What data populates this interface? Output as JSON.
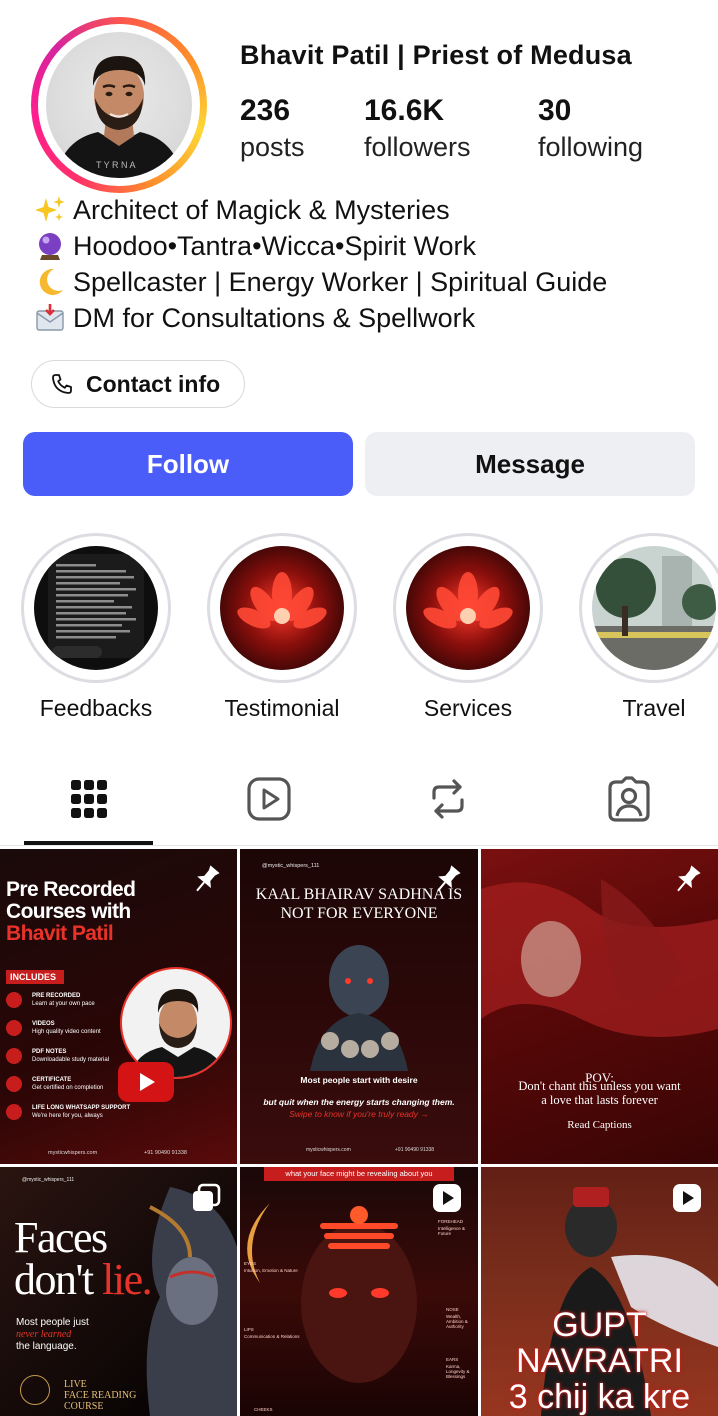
{
  "profile": {
    "name": "Bhavit Patil | Priest of Medusa",
    "stats": [
      {
        "value": "236",
        "label": "posts"
      },
      {
        "value": "16.6K",
        "label": "followers"
      },
      {
        "value": "30",
        "label": "following"
      }
    ],
    "bio": [
      {
        "emoji": "sparkles-icon",
        "text": "Architect of Magick & Mysteries"
      },
      {
        "emoji": "crystal-ball-icon",
        "text": "Hoodoo•Tantra•Wicca•Spirit Work"
      },
      {
        "emoji": "crescent-moon-icon",
        "text": "Spellcaster | Energy Worker | Spiritual Guide"
      },
      {
        "emoji": "inbox-envelope-icon",
        "text": "DM for Consultations & Spellwork"
      }
    ],
    "contact_label": "Contact info"
  },
  "actions": {
    "follow": "Follow",
    "message": "Message",
    "follow_color": "#4a5df9"
  },
  "highlights": [
    {
      "label": "Feedbacks"
    },
    {
      "label": "Testimonial"
    },
    {
      "label": "Services"
    },
    {
      "label": "Travel"
    }
  ],
  "tabs": [
    "grid-icon",
    "reels-icon",
    "reposts-icon",
    "tagged-icon"
  ],
  "posts": [
    {
      "kind": "pinned",
      "title_lines": [
        "Pre Recorded",
        "Courses with"
      ],
      "title_accent": "Bhavit Patil",
      "includes_label": "INCLUDES",
      "features": [
        {
          "title": "PRE RECORDED",
          "sub": "Learn at your own pace"
        },
        {
          "title": "VIDEOS",
          "sub": "High quality video content"
        },
        {
          "title": "PDF NOTES",
          "sub": "Downloadable study material"
        },
        {
          "title": "CERTIFICATE",
          "sub": "Get certified on completion"
        },
        {
          "title": "LIFE LONG WHATSAPP SUPPORT",
          "sub": "We're here for you, always"
        }
      ],
      "footer_left": "mysticwhispers.com",
      "footer_right": "+91 90490 91338"
    },
    {
      "kind": "pinned",
      "handle": "@mystic_whispers_111",
      "headline": "KAAL BHAIRAV SADHNA IS NOT FOR EVERYONE",
      "line1": "Most people start with desire",
      "line2": "but quit when the energy starts changing them.",
      "cta": "Swipe to know if you're truly ready →",
      "footer_left": "mysticwhispers.com",
      "footer_right": "+91 90490 91338"
    },
    {
      "kind": "pinned",
      "pov": "POV:",
      "line1": "Don't chant this unless you want",
      "line2": "a love that lasts forever",
      "caption": "Read Captions"
    },
    {
      "kind": "carousel",
      "handle": "@mystic_whispers_111",
      "title1": "Faces",
      "title2": "don't",
      "title3": "lie.",
      "sub1": "Most people just",
      "sub2": "never learned",
      "sub3": "the language.",
      "badge1": "LIVE",
      "badge2": "FACE READING",
      "badge3": "COURSE"
    },
    {
      "kind": "reel",
      "banner": "what your face might be revealing about you",
      "tags": [
        "FOREHEAD",
        "Intelligence & Future",
        "EYES",
        "Intuition, Emotion & Nature",
        "NOSE",
        "Wealth, Ambition & Authority",
        "LIPS",
        "Communication & Relations",
        "EARS",
        "Karma, Longevity & Blessings",
        "CHEEKS"
      ]
    },
    {
      "kind": "reel",
      "title1": "GUPT",
      "title2": "NAVRATRI",
      "title3": "3 chij ka kre"
    }
  ]
}
